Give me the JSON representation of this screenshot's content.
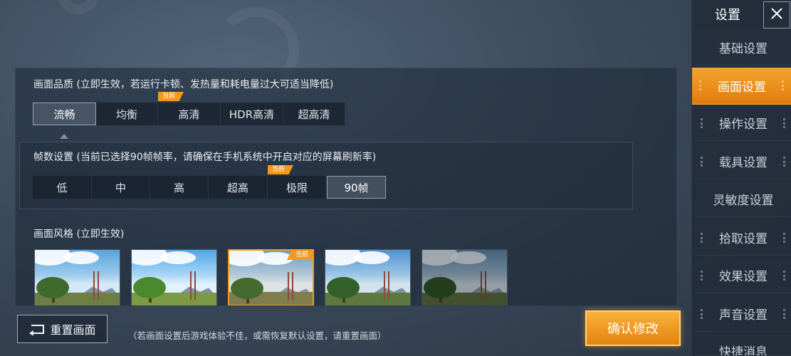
{
  "quality": {
    "title": "画面品质 (立即生效，若运行卡顿、发热量和耗电量过大可适当降低)",
    "options": [
      "流畅",
      "均衡",
      "高清",
      "HDR高清",
      "超高清"
    ],
    "selected": "流畅",
    "current_badge": "当前"
  },
  "fps": {
    "title": "帧数设置 (当前已选择90帧帧率，请确保在手机系统中开启对应的屏幕刷新率)",
    "options": [
      "低",
      "中",
      "高",
      "超高",
      "极限",
      "90帧"
    ],
    "selected": "90帧",
    "current_badge": "当前"
  },
  "style": {
    "title": "画面风格 (立即生效)",
    "current_badge": "当前"
  },
  "bottom": {
    "reset_label": "重置画面",
    "hint": "（若画面设置后游戏体验不佳，或需恢复默认设置，请重置画面）",
    "confirm_label": "确认修改"
  },
  "sidebar": {
    "title": "设置",
    "items": [
      {
        "label": "基础设置"
      },
      {
        "label": "画面设置"
      },
      {
        "label": "操作设置"
      },
      {
        "label": "载具设置"
      },
      {
        "label": "灵敏度设置"
      },
      {
        "label": "拾取设置"
      },
      {
        "label": "效果设置"
      },
      {
        "label": "声音设置"
      },
      {
        "label": "快捷消息"
      }
    ],
    "active": "画面设置"
  },
  "colors": {
    "accent": "#f39a1d",
    "panel": "#1c2634"
  },
  "icons": {
    "close": "close-icon",
    "reset": "reset-icon"
  }
}
